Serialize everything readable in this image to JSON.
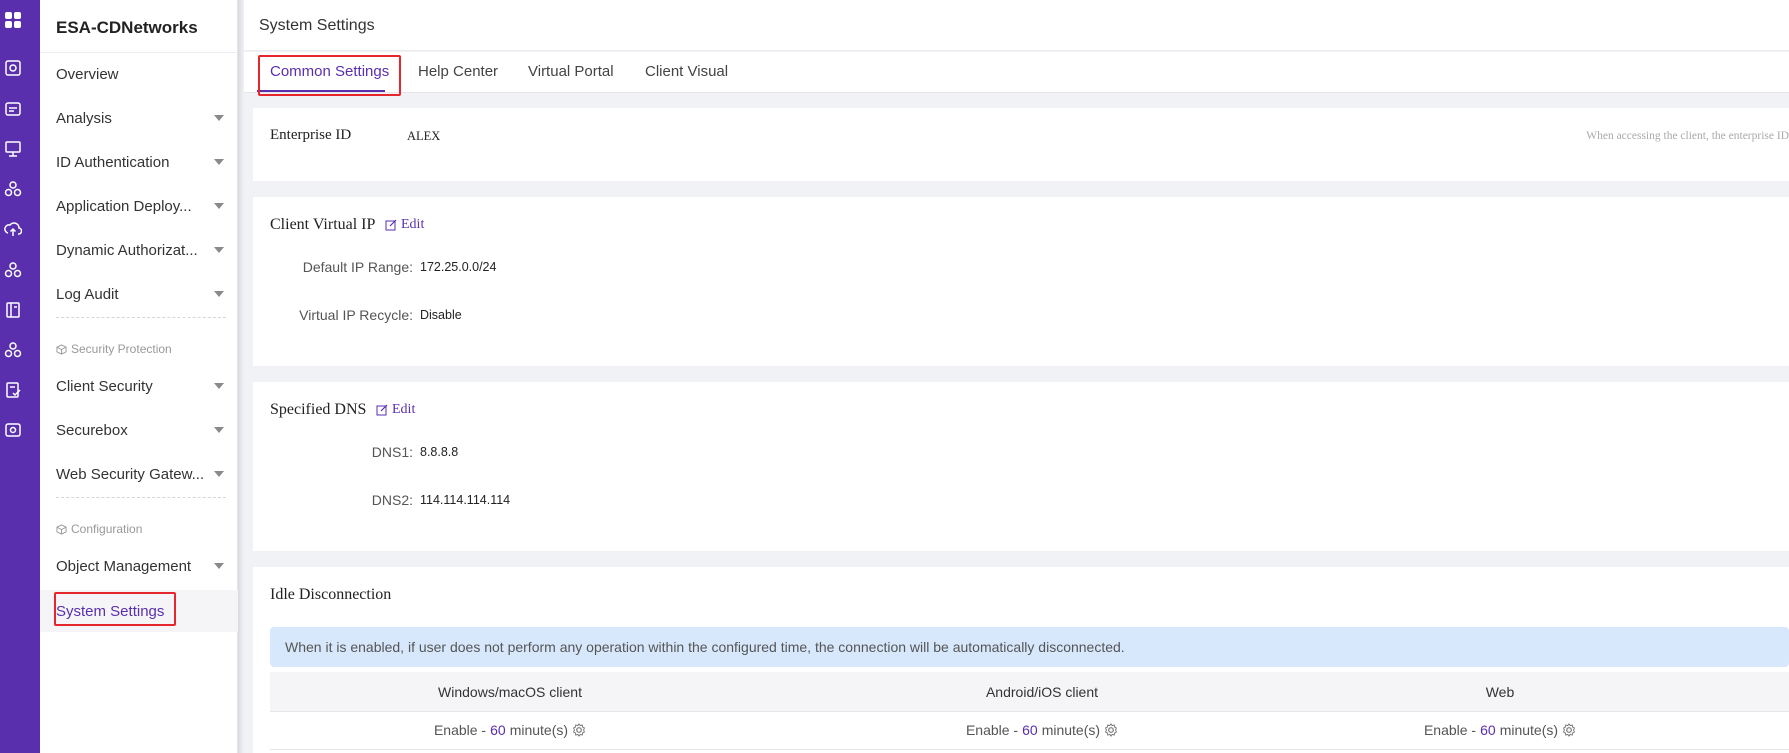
{
  "brand": "ESA-CDNetworks",
  "page_title": "System Settings",
  "rail_icons": [
    "apps-icon",
    "shield-icon",
    "id-card-icon",
    "monitor-icon",
    "cluster-icon",
    "cloud-upload-icon",
    "cluster-icon",
    "book-icon",
    "cluster-icon",
    "audit-icon",
    "gateway-icon"
  ],
  "sidebar": {
    "items": [
      {
        "label": "Overview"
      },
      {
        "label": "Analysis"
      },
      {
        "label": "ID Authentication"
      },
      {
        "label": "Application Deploy..."
      },
      {
        "label": "Dynamic Authorizat..."
      },
      {
        "label": "Log Audit"
      }
    ],
    "section_security": "Security Protection",
    "security_items": [
      {
        "label": "Client Security"
      },
      {
        "label": "Securebox"
      },
      {
        "label": "Web Security Gatew..."
      }
    ],
    "section_config": "Configuration",
    "config_items": [
      {
        "label": "Object Management"
      },
      {
        "label": "System Settings"
      }
    ]
  },
  "tabs": [
    "Common Settings",
    "Help Center",
    "Virtual Portal",
    "Client Visual"
  ],
  "enterprise": {
    "label": "Enterprise ID",
    "value": "ALEX",
    "hint": "When accessing the client, the enterprise ID"
  },
  "virtual_ip": {
    "title": "Client Virtual IP",
    "edit": "Edit",
    "range_label": "Default IP Range:",
    "range_value": "172.25.0.0/24",
    "recycle_label": "Virtual IP Recycle:",
    "recycle_value": "Disable"
  },
  "dns": {
    "title": "Specified DNS",
    "edit": "Edit",
    "dns1_label": "DNS1:",
    "dns1_value": "8.8.8.8",
    "dns2_label": "DNS2:",
    "dns2_value": "114.114.114.114"
  },
  "idle": {
    "title": "Idle Disconnection",
    "banner": "When it is enabled, if user does not perform any operation within the configured time, the connection will be automatically disconnected.",
    "columns": [
      "Windows/macOS client",
      "Android/iOS client",
      "Web"
    ],
    "rows": [
      {
        "status": "Enable -",
        "value": "60",
        "unit": "minute(s)"
      },
      {
        "status": "Enable -",
        "value": "60",
        "unit": "minute(s)"
      },
      {
        "status": "Enable -",
        "value": "60",
        "unit": "minute(s)"
      }
    ]
  },
  "colors": {
    "accent": "#5a2fae",
    "highlight": "#e5262d",
    "banner": "#d7e8fc"
  }
}
